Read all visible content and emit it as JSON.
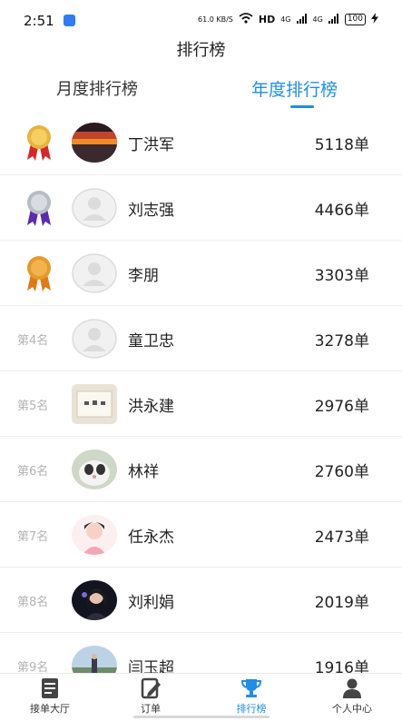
{
  "status_bar": {
    "time": "2:51",
    "net_speed": "61.0 KB/S",
    "hd": "HD",
    "signal_a": "4G",
    "signal_b": "4G",
    "battery": "100"
  },
  "header": {
    "title": "排行榜"
  },
  "tabs": [
    {
      "label": "月度排行榜",
      "active": false
    },
    {
      "label": "年度排行榜",
      "active": true
    }
  ],
  "ranking": [
    {
      "rank_label": "",
      "medal": "gold",
      "name": "丁洪军",
      "count": "5118单",
      "avatar": "sunset-photo"
    },
    {
      "rank_label": "",
      "medal": "silver",
      "name": "刘志强",
      "count": "4466单",
      "avatar": "default-person"
    },
    {
      "rank_label": "",
      "medal": "bronze",
      "name": "李朋",
      "count": "3303单",
      "avatar": "default-person"
    },
    {
      "rank_label": "第4名",
      "medal": "",
      "name": "童卫忠",
      "count": "3278单",
      "avatar": "default-person"
    },
    {
      "rank_label": "第5名",
      "medal": "",
      "name": "洪永建",
      "count": "2976单",
      "avatar": "calligraphy-photo"
    },
    {
      "rank_label": "第6名",
      "medal": "",
      "name": "林祥",
      "count": "2760单",
      "avatar": "cat-photo"
    },
    {
      "rank_label": "第7名",
      "medal": "",
      "name": "任永杰",
      "count": "2473单",
      "avatar": "cartoon-photo"
    },
    {
      "rank_label": "第8名",
      "medal": "",
      "name": "刘利娟",
      "count": "2019单",
      "avatar": "portrait-photo"
    },
    {
      "rank_label": "第9名",
      "medal": "",
      "name": "闫玉超",
      "count": "1916单",
      "avatar": "outdoor-photo"
    }
  ],
  "bottom_nav": [
    {
      "label": "接单大厅",
      "icon": "document-icon",
      "active": false
    },
    {
      "label": "订单",
      "icon": "order-pen-icon",
      "active": false
    },
    {
      "label": "排行榜",
      "icon": "trophy-icon",
      "active": true
    },
    {
      "label": "个人中心",
      "icon": "person-icon",
      "active": false
    }
  ],
  "colors": {
    "accent": "#1f8ee6",
    "gold": "#e8b43a",
    "silver": "#b8bcc4",
    "bronze": "#e59a2a",
    "ribbon_red": "#d7262b",
    "ribbon_purple": "#5a2bb0"
  }
}
